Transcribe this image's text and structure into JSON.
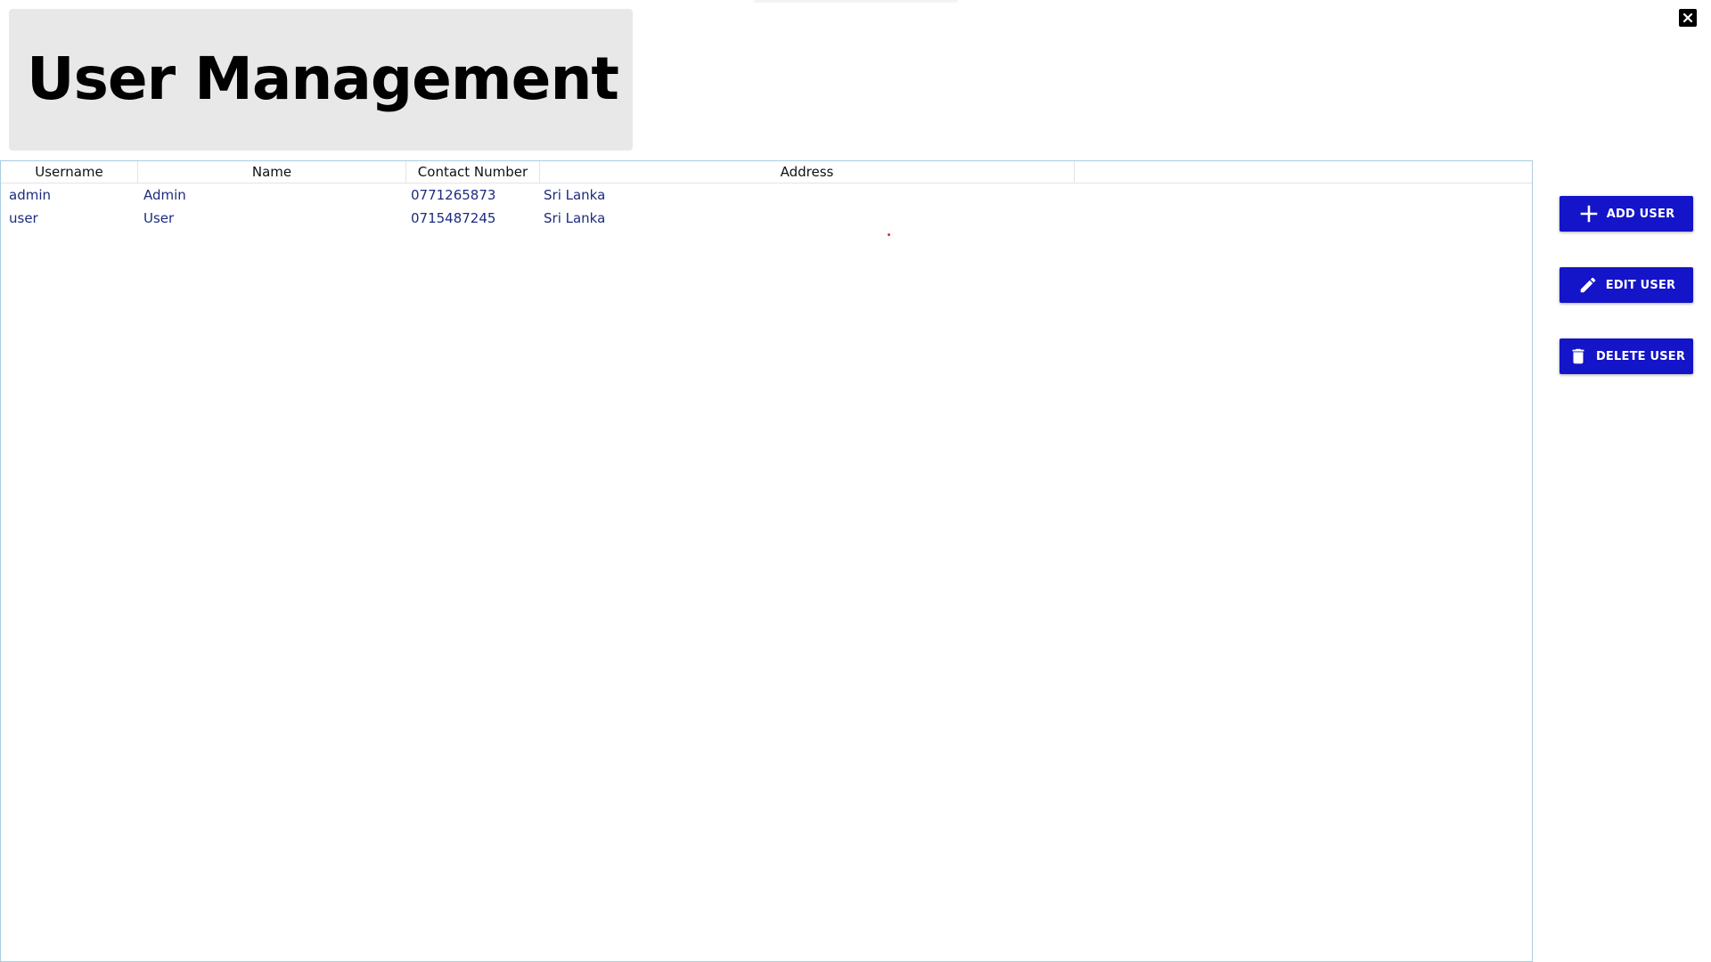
{
  "header": {
    "title": "User Management"
  },
  "window": {
    "close_icon": "close-icon"
  },
  "table": {
    "columns": [
      "Username",
      "Name",
      "Contact Number",
      "Address"
    ],
    "rows": [
      {
        "username": "admin",
        "name": "Admin",
        "contact": "0771265873",
        "address": "Sri Lanka"
      },
      {
        "username": "user",
        "name": "User",
        "contact": "0715487245",
        "address": "Sri Lanka"
      }
    ]
  },
  "actions": {
    "add_label": "ADD USER",
    "edit_label": "EDIT USER",
    "delete_label": "DELETE USER",
    "add_icon": "plus-icon",
    "edit_icon": "pencil-icon",
    "delete_icon": "trash-icon"
  },
  "colors": {
    "button_bg": "#1414c8",
    "row_text": "#1d2b80",
    "grid_border": "#a9cde0",
    "title_panel": "#e8e8e8"
  }
}
